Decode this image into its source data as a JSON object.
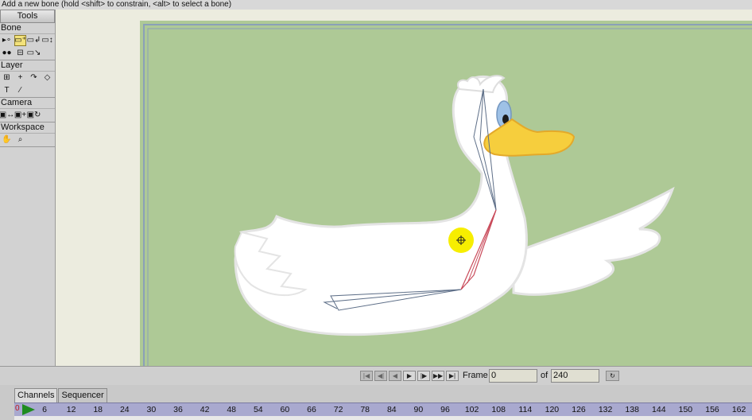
{
  "status_message": "Add a new bone (hold <shift> to constrain, <alt> to select a bone)",
  "tools": {
    "title": "Tools",
    "sections": [
      {
        "label": "Bone",
        "rows": [
          [
            "select-bone-icon",
            "add-bone-icon",
            "reparent-bone-icon",
            "bone-strength-icon"
          ],
          [
            "bind-layer-icon",
            "bind-points-icon",
            "offset-bone-icon"
          ]
        ]
      },
      {
        "label": "Layer",
        "rows": [
          [
            "transform-layer-icon",
            "set-origin-icon",
            "rotate-layer-icon",
            "shear-layer-icon"
          ],
          [
            "text-icon",
            "eyedropper-icon"
          ]
        ]
      },
      {
        "label": "Camera",
        "rows": [
          [
            "track-camera-icon",
            "zoom-camera-icon",
            "roll-camera-icon"
          ]
        ]
      },
      {
        "label": "Workspace",
        "rows": [
          [
            "pan-icon",
            "zoom-icon"
          ]
        ]
      }
    ],
    "active_tool": "add-bone-icon"
  },
  "canvas": {
    "background": "#aec996",
    "cursor_icon": "move-cursor-icon"
  },
  "playback": {
    "buttons": [
      "rewind-icon",
      "step-back-icon",
      "play-reverse-icon",
      "play-icon",
      "step-forward-icon",
      "fast-forward-icon",
      "end-icon"
    ],
    "frame_label": "Frame",
    "frame_value": "0",
    "of_label": "of",
    "total_frames": "240",
    "settings_icon": "loop-icon"
  },
  "timeline": {
    "tabs": [
      {
        "label": "Channels",
        "active": true
      },
      {
        "label": "Sequencer",
        "active": false
      }
    ],
    "zero_label": "0",
    "ticks": [
      "6",
      "12",
      "18",
      "24",
      "30",
      "36",
      "42",
      "48",
      "54",
      "60",
      "66",
      "72",
      "78",
      "84",
      "90",
      "96",
      "102",
      "108",
      "114",
      "120",
      "126",
      "132",
      "138",
      "144",
      "150",
      "156",
      "162"
    ]
  }
}
